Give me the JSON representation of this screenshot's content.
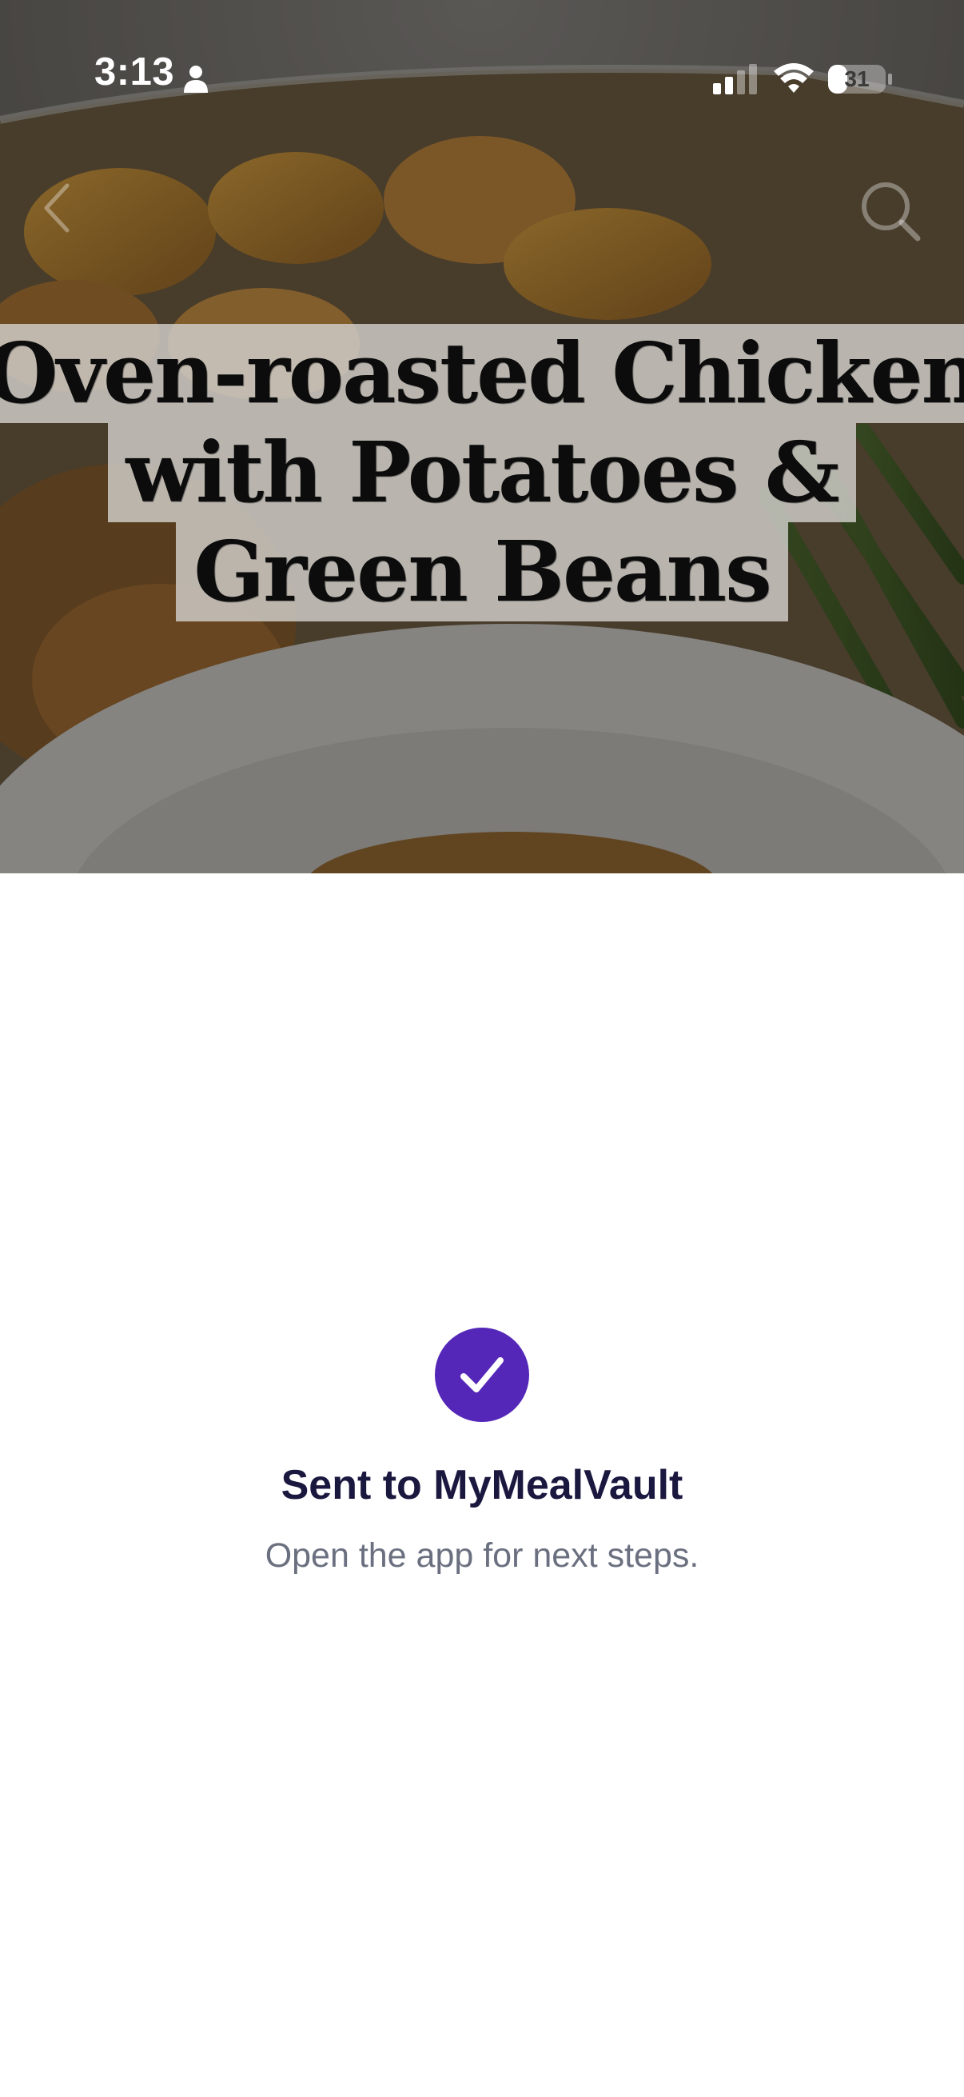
{
  "status_bar": {
    "time": "3:13",
    "battery_level": "31",
    "icons": [
      "person-icon",
      "cellular-signal-icon",
      "wifi-icon",
      "battery-icon"
    ]
  },
  "nav": {
    "back_icon": "chevron-left-icon",
    "search_icon": "search-icon"
  },
  "video": {
    "title_lines": [
      "Oven-roasted Chicken",
      "with Potatoes &",
      "Green Beans"
    ]
  },
  "confirmation": {
    "icon": "checkmark-icon",
    "title": "Sent to MyMealVault",
    "subtitle": "Open the app for next steps.",
    "accent_color": "#5527b8"
  }
}
